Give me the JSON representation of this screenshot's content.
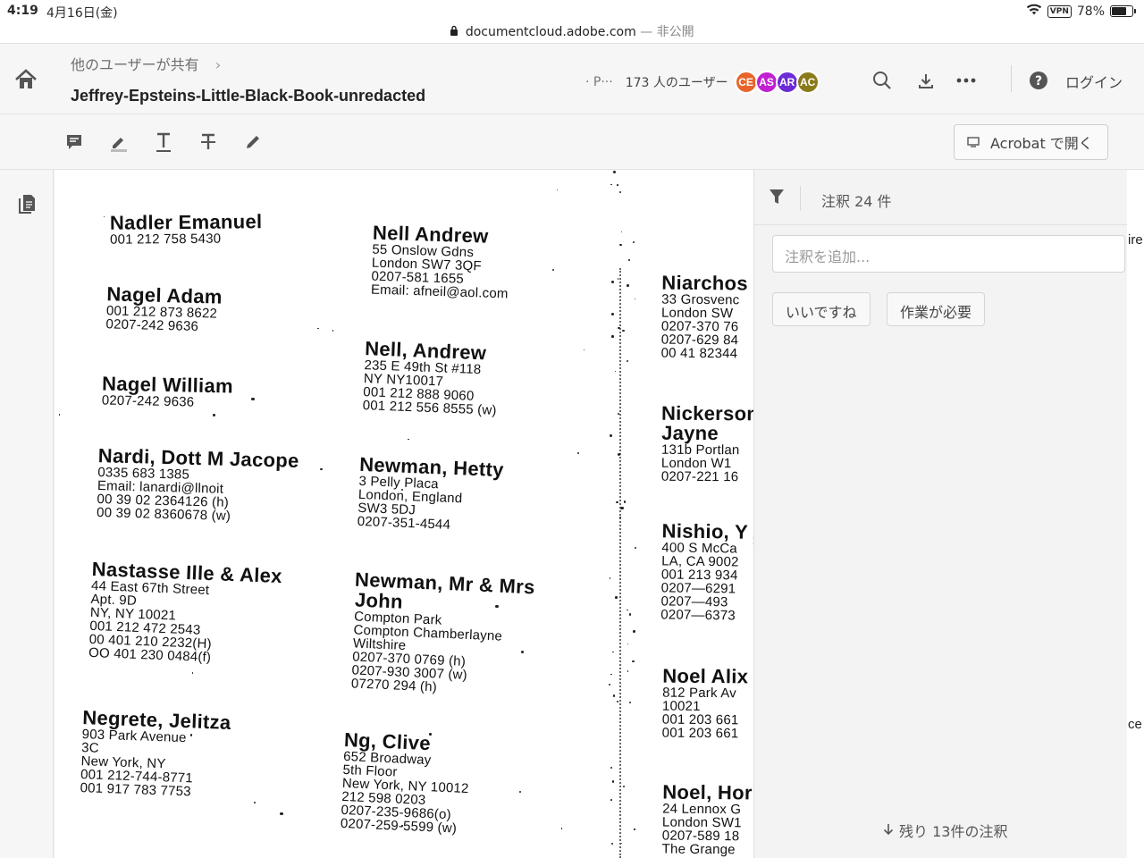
{
  "status": {
    "time": "4:19",
    "date": "4月16日(金)",
    "url": "documentcloud.adobe.com",
    "url_suffix": "— 非公開",
    "vpn": "VPN",
    "battery": "78%",
    "battery_level": 0.78
  },
  "header": {
    "breadcrumb": "他のユーザーが共有",
    "title": "Jeffrey-Epsteins-Little-Black-Book-unredacted",
    "presence_truncated": "· P···",
    "user_count": "173 人のユーザー",
    "avatars": [
      {
        "initials": "CE",
        "color": "#e8642a"
      },
      {
        "initials": "AS",
        "color": "#c020d0"
      },
      {
        "initials": "AR",
        "color": "#6b2bd6"
      },
      {
        "initials": "AC",
        "color": "#8a7a1a"
      }
    ],
    "login": "ログイン"
  },
  "toolbar": {
    "open_acrobat": "Acrobat で開く"
  },
  "panel": {
    "count": "注釈 24 件",
    "add_placeholder": "注釈を追加...",
    "chip_like": "いいですね",
    "chip_action": "作業が必要",
    "remaining": "残り 13件の注釈",
    "edge_text_1": "ire",
    "edge_text_2": "ce"
  },
  "document": {
    "col1": [
      {
        "name": "Nadler Emanuel",
        "lines": [
          "001 212 758 5430"
        ]
      },
      {
        "name": "Nagel  Adam",
        "lines": [
          "001 212 873 8622",
          "0207-242 9636"
        ]
      },
      {
        "name": "Nagel William",
        "lines": [
          "0207-242 9636"
        ]
      },
      {
        "name": "Nardi, Dott M Jacope",
        "lines": [
          "0335 683 1385",
          "Email: lanardi@llnoit",
          "00 39 02 2364126 (h)",
          "00 39 02 8360678 (w)"
        ]
      },
      {
        "name": "Nastasse Ille & Alex",
        "lines": [
          "44 East 67th Street",
          "Apt. 9D",
          "NY, NY 10021",
          "001 212 472 2543",
          "00 401 210 2232(H)",
          "OO 401 230 0484(f)"
        ]
      },
      {
        "name": "Negrete, Jelitza",
        "lines": [
          "903 Park Avenue",
          "3C",
          "New York, NY",
          "001 212-744-8771",
          "001 917 783 7753"
        ]
      }
    ],
    "col2": [
      {
        "name": "Nell Andrew",
        "lines": [
          "55 Onslow Gdns",
          "London SW7 3QF",
          "0207-581 1655",
          "Email: afneil@aol.com"
        ]
      },
      {
        "name": "Nell, Andrew",
        "lines": [
          "235 E 49th St #118",
          "NY  NY10017",
          "001 212 888 9060",
          "001 212 556 8555 (w)"
        ]
      },
      {
        "name": "Newman, Hetty",
        "lines": [
          "3 Pelly Placa",
          "London, England",
          "SW3 5DJ",
          "0207-351-4544"
        ]
      },
      {
        "name": "Newman, Mr & Mrs",
        "lines": []
      },
      {
        "name": "John",
        "lines": [
          "Compton Park",
          "Compton Chamberlayne",
          "Wiltshire",
          "0207-370 0769 (h)",
          "0207-930 3007 (w)",
          "07270 294 (h)"
        ]
      },
      {
        "name": "Ng, Clive",
        "lines": [
          "652 Broadway",
          "5th Floor",
          "New York, NY 10012",
          "212 598 0203",
          "0207-235-9686(o)",
          "0207-259-5599 (w)"
        ]
      }
    ],
    "col3": [
      {
        "name": "Niarchos",
        "lines": [
          "33 Grosvenc",
          "London   SW",
          "0207-370 76",
          "0207-629 84",
          "00 41 82344"
        ]
      },
      {
        "name": "Nickerson",
        "lines": []
      },
      {
        "name": "Jayne",
        "lines": [
          "131b Portlan",
          "London  W1",
          "0207-221 16"
        ]
      },
      {
        "name": "Nishio, Y",
        "lines": [
          "400 S McCa",
          "LA, CA 9002",
          "001 213 934",
          " 0207—6291",
          " 0207—493 ",
          " 0207—6373"
        ]
      },
      {
        "name": "Noel Alix",
        "lines": [
          "812 Park Av",
          "10021",
          "001 203 661",
          "001 203 661"
        ]
      },
      {
        "name": "Noel, Hor",
        "lines": [
          "24 Lennox G",
          "London SW1",
          "0207-589 18",
          "The Grange"
        ]
      }
    ]
  }
}
